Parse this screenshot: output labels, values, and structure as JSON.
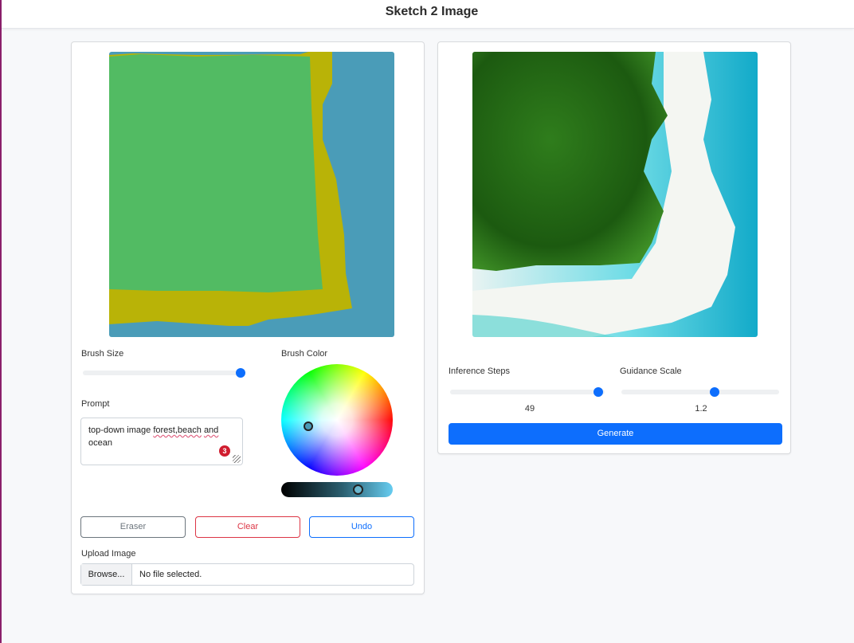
{
  "app": {
    "title": "Sketch 2 Image"
  },
  "sketch": {
    "brush_size_label": "Brush Size",
    "brush_size_value": 1.0,
    "brush_color_label": "Brush Color",
    "brush_color": "#4a9cb8",
    "prompt_label": "Prompt",
    "prompt_text_plain": "top-down image ",
    "prompt_word1": "forest,beach",
    "prompt_sep": " ",
    "prompt_word2": "and",
    "prompt_text_tail": " ocean",
    "prompt_badge": "3",
    "colors": {
      "forest": "#52bb63",
      "sand": "#b9b307",
      "water": "#4a9cb8"
    }
  },
  "buttons": {
    "eraser": "Eraser",
    "clear": "Clear",
    "undo": "Undo"
  },
  "upload": {
    "label": "Upload Image",
    "browse": "Browse...",
    "file_status": "No file selected."
  },
  "output": {
    "inference_steps_label": "Inference Steps",
    "inference_steps_value": "49",
    "guidance_scale_label": "Guidance Scale",
    "guidance_scale_value": "1.2",
    "generate_label": "Generate"
  },
  "icons": {
    "browse": "file-picker",
    "resize": "resize-handle-icon"
  },
  "accent": "#0d6efd"
}
